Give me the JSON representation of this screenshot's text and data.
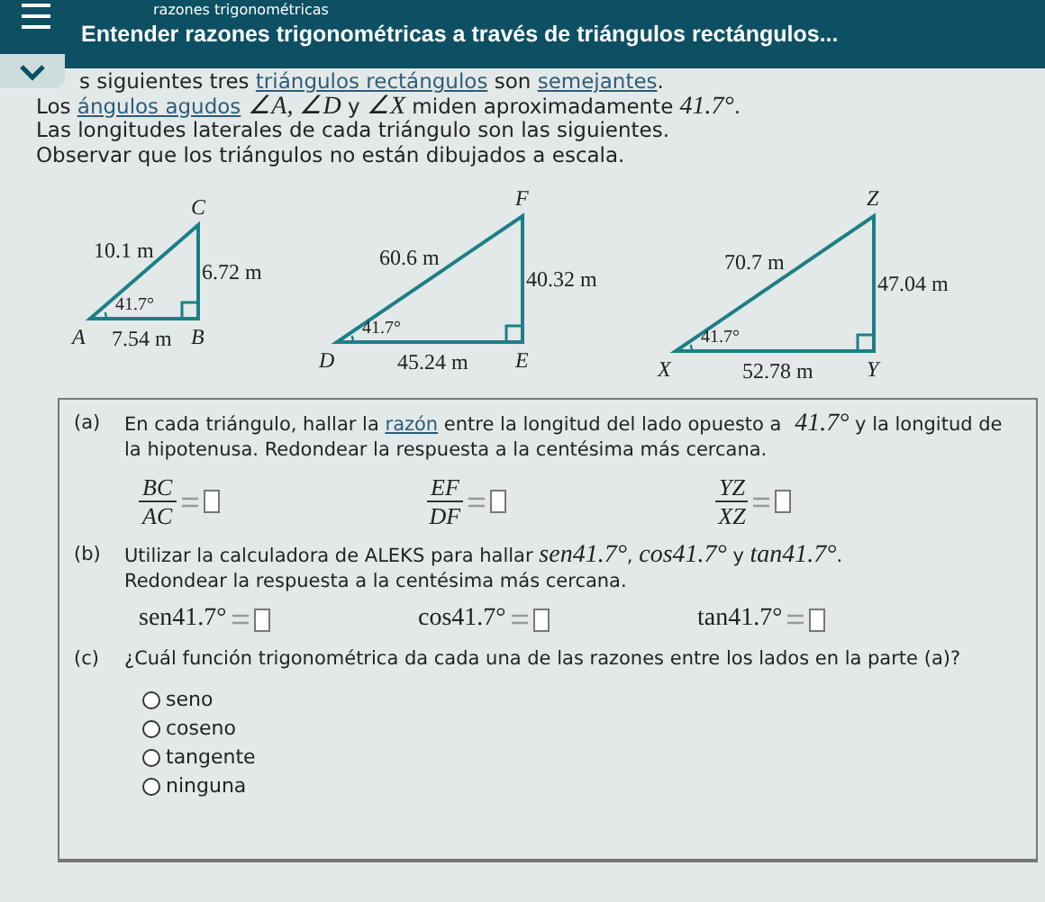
{
  "header": {
    "breadcrumb": "razones trigonométricas",
    "title": "Entender razones trigonométricas a través de triángulos rectángulos..."
  },
  "intro": [
    [
      {
        "kind": "plain",
        "text": "s siguientes tres "
      },
      {
        "kind": "link",
        "text": "triángulos rectángulos"
      },
      {
        "kind": "plain",
        "text": " son "
      },
      {
        "kind": "link",
        "text": "semejantes"
      },
      {
        "kind": "plain",
        "text": "."
      }
    ],
    [
      {
        "kind": "plain",
        "text": "Los "
      },
      {
        "kind": "link",
        "text": "ángulos agudos"
      },
      {
        "kind": "math",
        "text": "∠A, ∠D"
      },
      {
        "kind": "plain",
        "text": " y "
      },
      {
        "kind": "math",
        "text": "∠X"
      },
      {
        "kind": "plain",
        "text": " miden aproximadamente "
      },
      {
        "kind": "math",
        "text": "41.7°"
      },
      {
        "kind": "plain",
        "text": "."
      }
    ],
    [
      {
        "kind": "plain",
        "text": "Las longitudes laterales de cada triángulo son las siguientes."
      }
    ],
    [
      {
        "kind": "plain",
        "text": "Observar que los triángulos no están dibujados a escala."
      }
    ]
  ],
  "triangles": [
    {
      "vertices": [
        "A",
        "B",
        "C"
      ],
      "hypotenuse": "10.1 m",
      "opposite": "6.72 m",
      "adjacent": "7.54 m",
      "angle": "41.7°"
    },
    {
      "vertices": [
        "D",
        "E",
        "F"
      ],
      "hypotenuse": "60.6 m",
      "opposite": "40.32 m",
      "adjacent": "45.24 m",
      "angle": "41.7°"
    },
    {
      "vertices": [
        "X",
        "Y",
        "Z"
      ],
      "hypotenuse": "70.7 m",
      "opposite": "47.04 m",
      "adjacent": "52.78 m",
      "angle": "41.7°"
    }
  ],
  "part_a": {
    "label": "(a)",
    "text": [
      {
        "kind": "plain",
        "text": "En cada triángulo, hallar la "
      },
      {
        "kind": "link",
        "text": "razón"
      },
      {
        "kind": "plain",
        "text": " entre la longitud del lado opuesto a "
      },
      {
        "kind": "math",
        "text": "41.7°"
      },
      {
        "kind": "plain",
        "text": " y la longitud de la hipotenusa. Redondear la respuesta a la centésima más cercana."
      }
    ],
    "fractions": [
      {
        "numerator": "BC",
        "denominator": "AC"
      },
      {
        "numerator": "EF",
        "denominator": "DF"
      },
      {
        "numerator": "YZ",
        "denominator": "XZ"
      }
    ]
  },
  "part_b": {
    "label": "(b)",
    "text": [
      {
        "kind": "plain",
        "text": "Utilizar la calculadora de ALEKS para hallar "
      },
      {
        "kind": "math",
        "text": "sen41.7°"
      },
      {
        "kind": "plain",
        "text": ", "
      },
      {
        "kind": "math",
        "text": "cos41.7°"
      },
      {
        "kind": "plain",
        "text": " y "
      },
      {
        "kind": "math",
        "text": "tan41.7°"
      },
      {
        "kind": "plain",
        "text": "."
      }
    ],
    "note": "Redondear la respuesta a la centésima más cercana.",
    "expressions": [
      "sen41.7°",
      "cos41.7°",
      "tan41.7°"
    ]
  },
  "part_c": {
    "label": "(c)",
    "question": "¿Cuál función trigonométrica da cada una de las razones entre los lados en la parte (a)?",
    "options": [
      {
        "label": "seno",
        "selected": false
      },
      {
        "label": "coseno",
        "selected": false
      },
      {
        "label": "tangente",
        "selected": false
      },
      {
        "label": "ninguna",
        "selected": false
      }
    ]
  }
}
